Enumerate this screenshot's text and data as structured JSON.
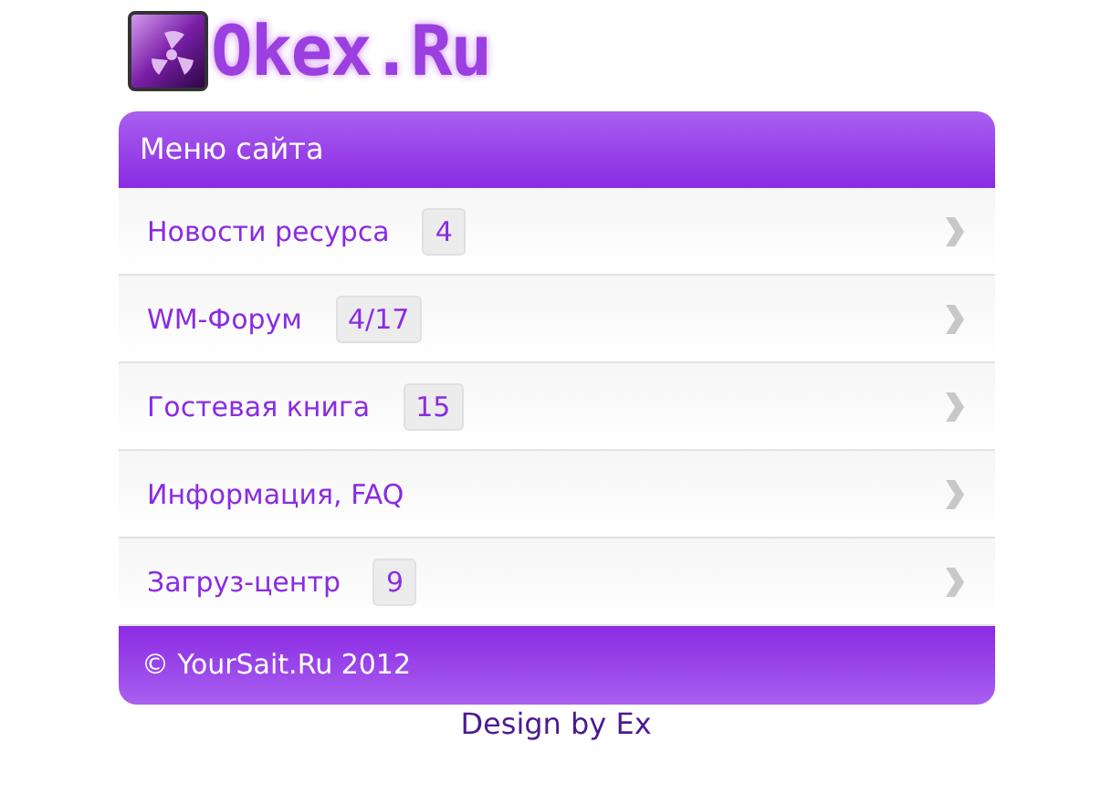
{
  "logo": {
    "text": "Okex.Ru"
  },
  "menu": {
    "title": "Меню сайта",
    "items": [
      {
        "label": "Новости ресурса",
        "count": "4"
      },
      {
        "label": "WM-Форум",
        "count": "4/17"
      },
      {
        "label": "Гостевая книга",
        "count": "15"
      },
      {
        "label": "Информация, FAQ"
      },
      {
        "label": "Загруз-центр",
        "count": "9"
      }
    ],
    "footer": "© YourSait.Ru 2012"
  },
  "credit": "Design by Ex"
}
